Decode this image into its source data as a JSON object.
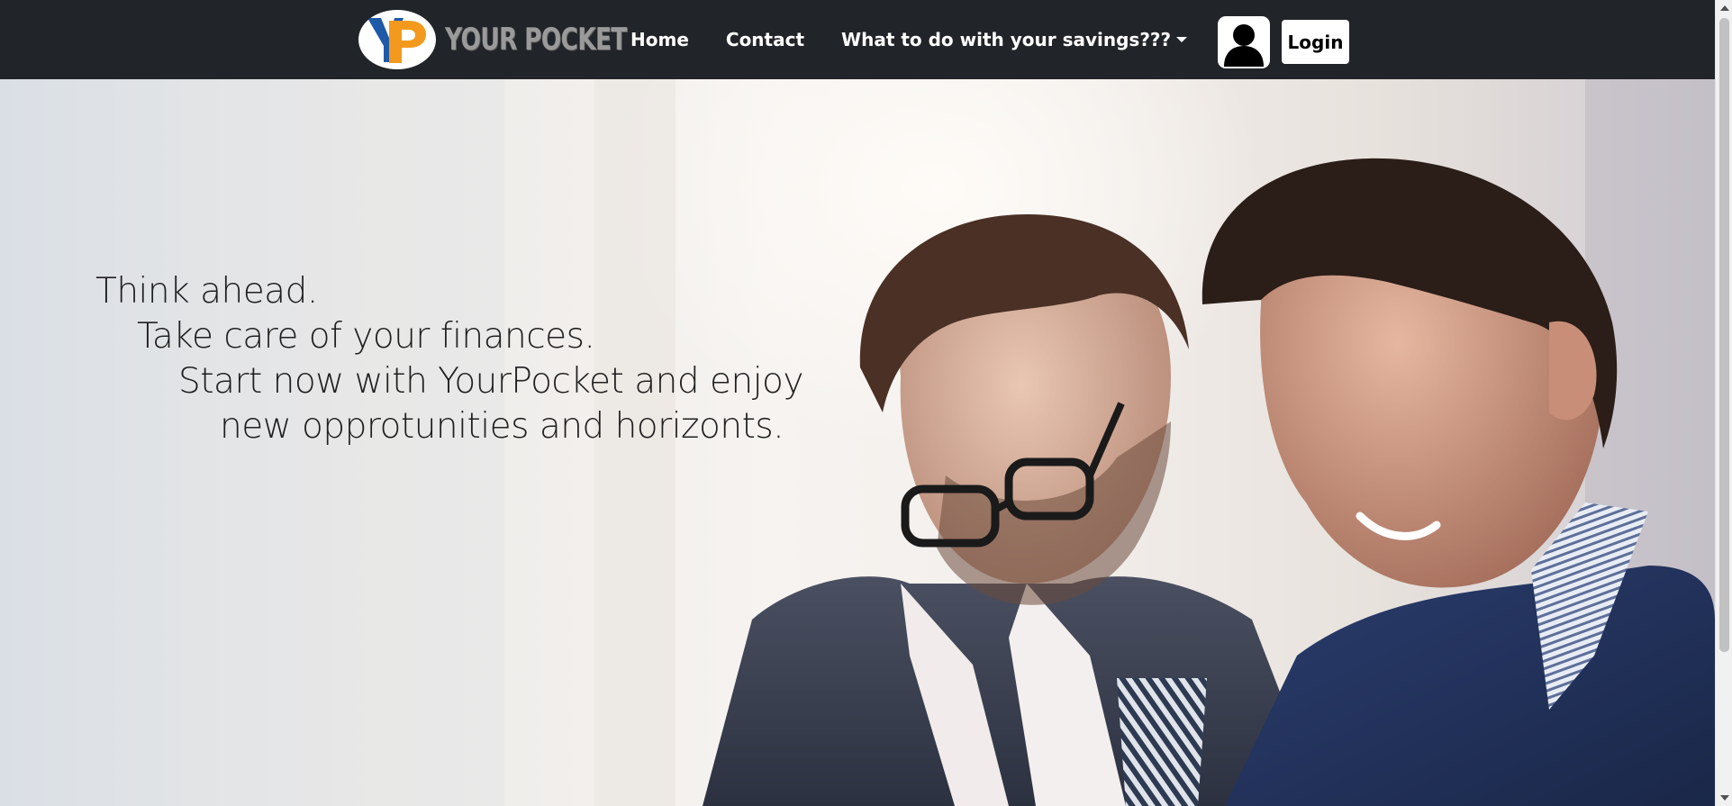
{
  "navbar": {
    "brand": {
      "logo_letters": "YP",
      "name": "YOUR POCKET"
    },
    "links": [
      {
        "label": "Home"
      },
      {
        "label": "Contact"
      },
      {
        "label": "What to do with your savings???"
      }
    ],
    "user_icon": "user-avatar-icon",
    "login_label": "Login"
  },
  "hero": {
    "lines": [
      "Think ahead.",
      "Take care of your finances.",
      "Start now with YourPocket and enjoy",
      "new opprotunities and horizonts."
    ],
    "image": "two-businessmen-smiling-photo"
  },
  "colors": {
    "navbar_bg": "#212529",
    "logo_blue": "#1f5aa8",
    "logo_orange": "#f39a1e",
    "brand_text": "#9a9a9a"
  }
}
